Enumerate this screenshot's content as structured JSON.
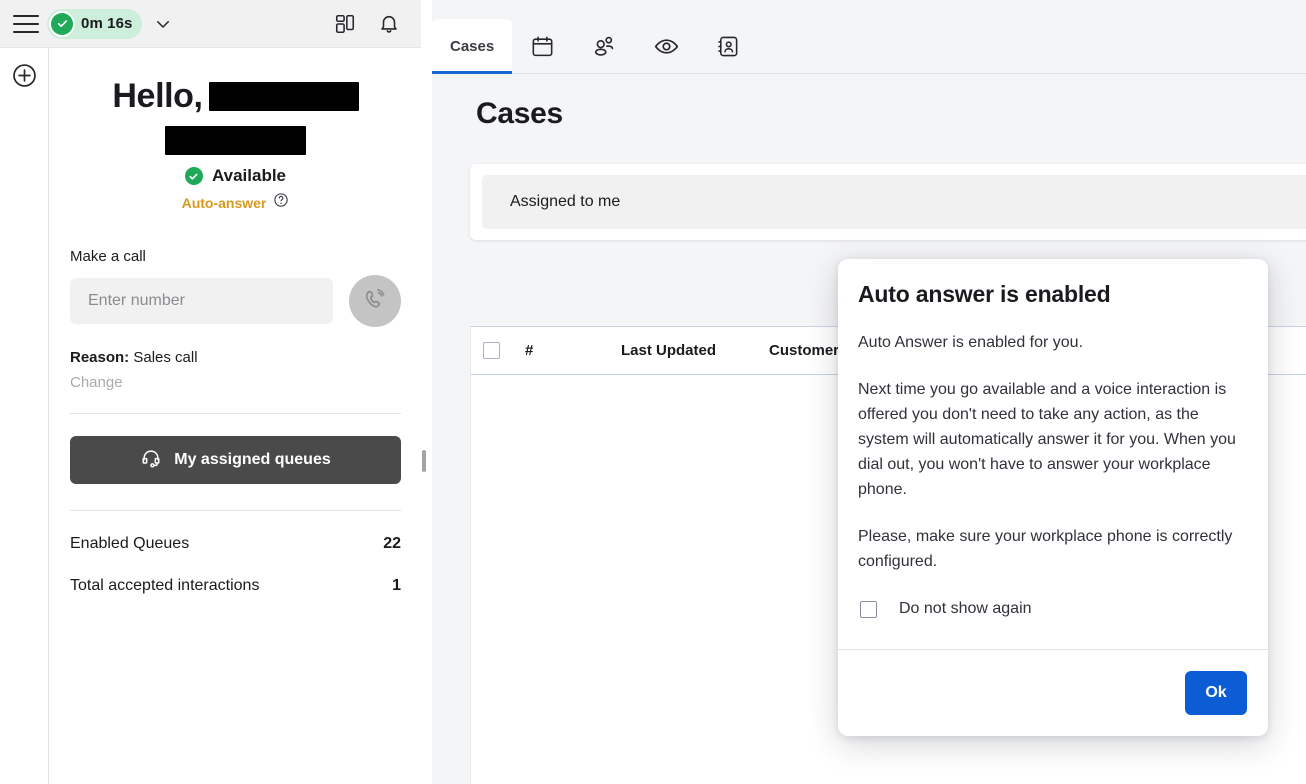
{
  "topbar": {
    "menu_icon": "hamburger-icon",
    "status_time": "0m 16s",
    "status_icon": "check-circle-icon",
    "chevron_icon": "chevron-down-icon",
    "dashboard_icon": "dashboard-grid-icon",
    "notifications_icon": "bell-icon"
  },
  "rail": {
    "add_icon": "plus-circle-icon"
  },
  "agent": {
    "greeting": "Hello,",
    "name_redacted_1": "",
    "name_redacted_2": "",
    "availability_label": "Available",
    "availability_icon": "check-circle-icon",
    "auto_answer_label": "Auto-answer",
    "help_icon": "question-circle-icon",
    "make_a_call_label": "Make a call",
    "number_placeholder": "Enter number",
    "number_value": "",
    "call_icon": "phone-call-icon",
    "reason_label": "Reason:",
    "reason_value": "Sales call",
    "change_label": "Change",
    "queues_button_label": "My assigned queues",
    "queues_icon": "headset-icon",
    "stats": [
      {
        "label": "Enabled Queues",
        "value": "22"
      },
      {
        "label": "Total accepted interactions",
        "value": "1"
      }
    ]
  },
  "main": {
    "tabs": [
      {
        "label": "Cases",
        "icon": "",
        "active": true
      },
      {
        "label": "",
        "icon": "calendar-icon",
        "active": false
      },
      {
        "label": "",
        "icon": "people-icon",
        "active": false
      },
      {
        "label": "",
        "icon": "eye-icon",
        "active": false
      },
      {
        "label": "",
        "icon": "contact-card-icon",
        "active": false
      }
    ],
    "page_title": "Cases",
    "filter_label": "Assigned to me",
    "table": {
      "columns": [
        "",
        "#",
        "Last Updated",
        "Customer"
      ]
    }
  },
  "modal": {
    "title": "Auto answer is enabled",
    "paragraph_1": "Auto Answer is enabled for you.",
    "paragraph_2": "Next time you go available and a voice interaction is offered you don't need to take any action, as the system will automatically answer it for you. When you dial out, you won't have to answer your workplace phone.",
    "paragraph_3": "Please, make sure your workplace phone is correctly configured.",
    "checkbox_label": "Do not show again",
    "ok_label": "Ok"
  },
  "colors": {
    "accent_blue": "#0b5cd5",
    "tab_underline": "#1767d6",
    "available_green": "#1faa5a",
    "status_pill_bg": "#cdeedb",
    "auto_answer_amber": "#d79a1e",
    "queues_button_bg": "#4a4a4a",
    "app_bg": "#f4f5f7"
  }
}
